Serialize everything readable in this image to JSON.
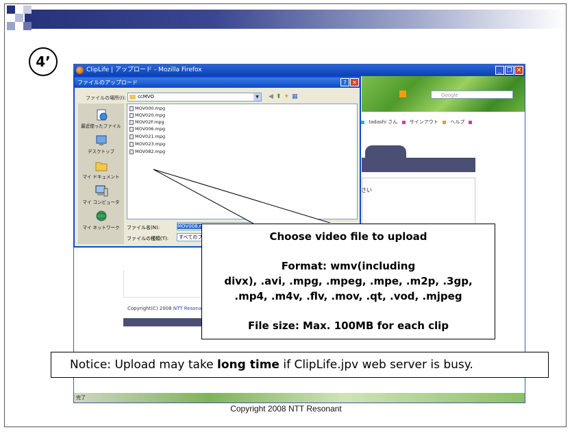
{
  "slide": {
    "step_label": "4’",
    "copyright": "Copyright 2008 NTT Resonant",
    "accent_color": "#26327a"
  },
  "browser": {
    "title": "ClipLife | アップロード - Mozilla Firefox",
    "search_placeholder": "Google",
    "nav_links": [
      "tadashi さん",
      "サインアウト",
      "ヘルプ"
    ],
    "page_text_fragment": "さい",
    "copyright_text": "Copyright(C) 2008 ",
    "copyright_link": "NTT Resonant",
    "status": "完了"
  },
  "dialog": {
    "title": "ファイルのアップロード",
    "look_in_label": "ファイルの場所(I):",
    "look_in_value": "ccMVO",
    "places": [
      {
        "label": "最近使ったファイル"
      },
      {
        "label": "デスクトップ"
      },
      {
        "label": "マイ ドキュメント"
      },
      {
        "label": "マイ コンピュータ"
      },
      {
        "label": "マイ ネットワーク"
      }
    ],
    "files": [
      "MOV000.mpg",
      "MOV020.mpg",
      "MOV02F.mpg",
      "MOV006.mpg",
      "MOV021.mpg",
      "MOV023.mpg",
      "MOV082.mpg"
    ],
    "file_name_label": "ファイル名(N):",
    "file_name_value": "MOV008.mpg",
    "file_type_label": "ファイルの種類(T):",
    "file_type_value": "すべてのファ"
  },
  "callout": {
    "line1": "Choose video file to upload",
    "line2": "Format: wmv(including",
    "line3": "divx), .avi, .mpg, .mpeg, .mpe, .m2p, .3gp,",
    "line4": ".mp4, .m4v, .flv, .mov, .qt, .vod, .mjpeg",
    "line5": "File size: Max. 100MB for each clip"
  },
  "notice": {
    "prefix": "Notice: Upload may take ",
    "bold": "long time",
    "suffix": " if ClipLife.jpv web server is busy."
  }
}
